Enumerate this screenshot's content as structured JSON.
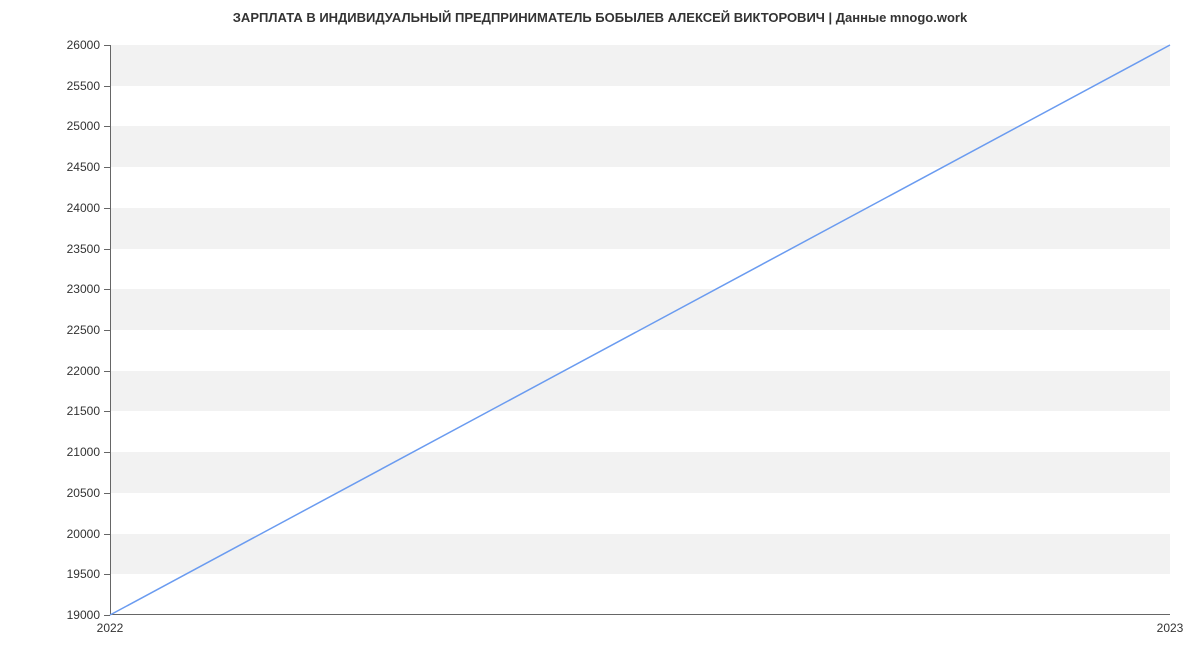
{
  "chart_data": {
    "type": "line",
    "title": "ЗАРПЛАТА В ИНДИВИДУАЛЬНЫЙ ПРЕДПРИНИМАТЕЛЬ БОБЫЛЕВ АЛЕКСЕЙ ВИКТОРОВИЧ | Данные mnogo.work",
    "x": [
      2022,
      2023
    ],
    "y": [
      19000,
      26000
    ],
    "xlabel": "",
    "ylabel": "",
    "x_ticks": [
      2022,
      2023
    ],
    "y_ticks": [
      19000,
      19500,
      20000,
      20500,
      21000,
      21500,
      22000,
      22500,
      23000,
      23500,
      24000,
      24500,
      25000,
      25500,
      26000
    ],
    "xlim": [
      2022,
      2023
    ],
    "ylim": [
      19000,
      26000
    ],
    "line_color": "#6a9bf0"
  }
}
